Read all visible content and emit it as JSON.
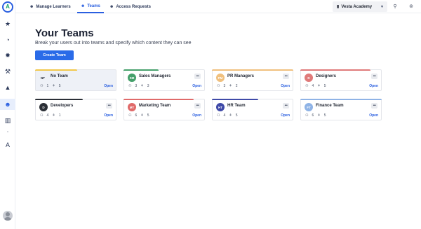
{
  "sidebar": {
    "logo": "A",
    "icons": [
      "star-icon",
      "gauge-icon",
      "gear-icon",
      "tools-icon",
      "graduation-cap-icon",
      "people-icon",
      "bar-chart-icon",
      "dot",
      "academy-logo-icon"
    ]
  },
  "topbar": {
    "tabs": [
      {
        "label": "Manage Learners"
      },
      {
        "label": "Teams"
      },
      {
        "label": "Access Requests"
      }
    ],
    "org": {
      "label": "Vesta Academy"
    }
  },
  "main": {
    "title": "Your Teams",
    "subtitle": "Break your users out into teams and specify which content they can see",
    "create_label": "Create Team",
    "open_label": "Open",
    "teams": [
      {
        "initials": "NT",
        "name": "No Team",
        "members": "1",
        "content": "5",
        "color": "",
        "bar": "#f2c84b",
        "selected": true
      },
      {
        "initials": "SM",
        "name": "Sales Managers",
        "members": "3",
        "content": "3",
        "color": "#45a06b",
        "bar": "#45a06b"
      },
      {
        "initials": "PM",
        "name": "PR Managers",
        "members": "3",
        "content": "2",
        "color": "#f0c07e",
        "bar": "#f0c07e"
      },
      {
        "initials": "D",
        "name": "Designers",
        "members": "4",
        "content": "5",
        "color": "#e07a7a",
        "bar": "#e07a7a"
      },
      {
        "initials": "D",
        "name": "Developers",
        "members": "4",
        "content": "1",
        "color": "#2b2f36",
        "bar": "#2b2f36"
      },
      {
        "initials": "MT",
        "name": "Marketing Team",
        "members": "6",
        "content": "5",
        "color": "#e06a6a",
        "bar": "#e06a6a"
      },
      {
        "initials": "HT",
        "name": "HR Team",
        "members": "4",
        "content": "5",
        "color": "#3f4aa8",
        "bar": "#3f4aa8"
      },
      {
        "initials": "FT",
        "name": "Finance Team",
        "members": "6",
        "content": "5",
        "color": "#8fb3e6",
        "bar": "#8fb3e6"
      }
    ]
  },
  "colors": {
    "accent": "#2a6be8"
  }
}
